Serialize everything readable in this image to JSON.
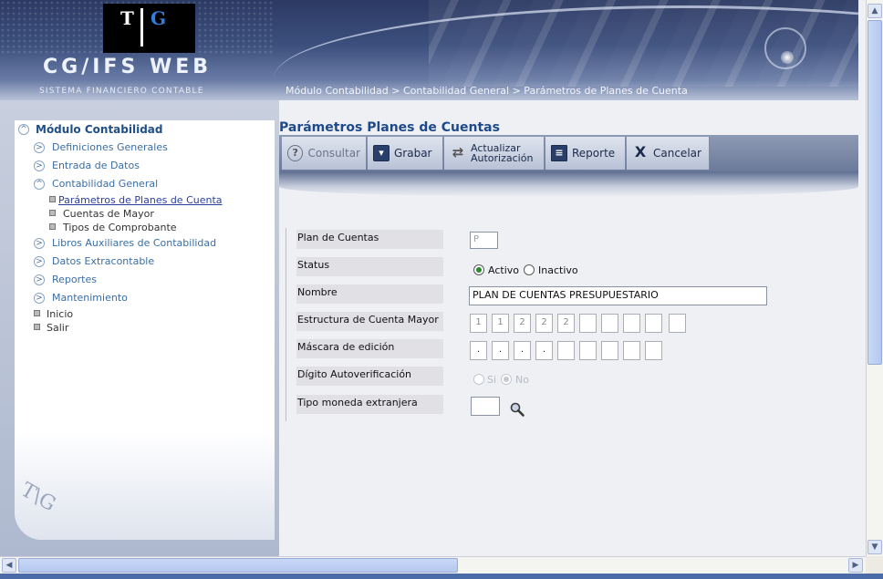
{
  "header": {
    "logo_t": "T",
    "logo_g": "G",
    "app_title": "CG/IFS WEB",
    "app_subtitle": "SISTEMA FINANCIERO CONTABLE",
    "breadcrumb": "Módulo Contabilidad > Contabilidad General > Parámetros de Planes de Cuenta"
  },
  "sidebar": {
    "module_title": "Módulo Contabilidad",
    "items": [
      {
        "label": "Definiciones Generales"
      },
      {
        "label": "Entrada de Datos"
      },
      {
        "label": "Contabilidad General"
      },
      {
        "label": "Libros Auxiliares de Contabilidad"
      },
      {
        "label": "Datos Extracontable"
      },
      {
        "label": "Reportes"
      },
      {
        "label": "Mantenimiento"
      }
    ],
    "subitems": [
      {
        "label": "Parámetros de Planes de Cuenta"
      },
      {
        "label": "Cuentas de Mayor"
      },
      {
        "label": "Tipos de Comprobante"
      }
    ],
    "extra": [
      {
        "label": "Inicio"
      },
      {
        "label": "Salir"
      }
    ],
    "watermark": "T\\G"
  },
  "main": {
    "title": "Parámetros Planes de Cuentas",
    "toolbar": {
      "consultar": "Consultar",
      "grabar": "Grabar",
      "actualizar_line1": "Actualizar",
      "actualizar_line2": "Autorización",
      "reporte": "Reporte",
      "cancelar": "Cancelar"
    },
    "form": {
      "plan_label": "Plan de Cuentas",
      "plan_value": "P",
      "status_label": "Status",
      "status_activo": "Activo",
      "status_inactivo": "Inactivo",
      "status_selected": "Activo",
      "nombre_label": "Nombre",
      "nombre_value": "PLAN DE CUENTAS PRESUPUESTARIO",
      "estructura_label": "Estructura de Cuenta Mayor",
      "estructura_values": [
        "1",
        "1",
        "2",
        "2",
        "2",
        "",
        "",
        "",
        "",
        ""
      ],
      "mascara_label": "Máscara de edición",
      "mascara_values": [
        ".",
        ".",
        ".",
        ".",
        "",
        "",
        "",
        "",
        ""
      ],
      "digito_label": "Dígito Autoverificación",
      "digito_si": "Si",
      "digito_no": "No",
      "digito_selected": "No",
      "moneda_label": "Tipo moneda extranjera",
      "moneda_value": ""
    }
  },
  "colors": {
    "header_dark": "#2c3a63",
    "title_blue": "#1e4a8c",
    "link_blue": "#3a6ea5"
  }
}
